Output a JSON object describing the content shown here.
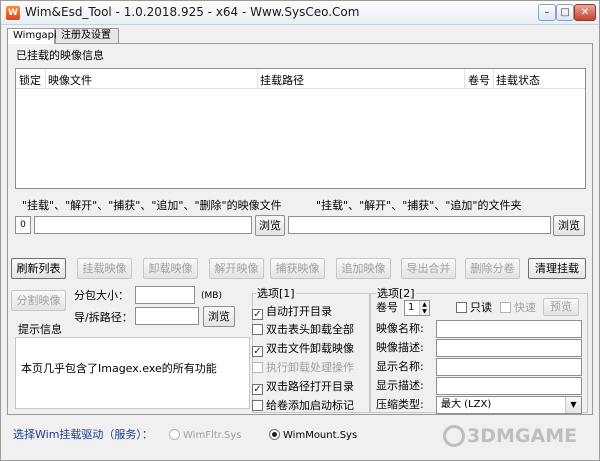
{
  "window": {
    "title": "Wim&Esd_Tool - 1.0.2018.925 - x64 - Www.SysCeo.Com",
    "min_glyph": "–",
    "max_glyph": "□",
    "close_glyph": "✕"
  },
  "tabs": [
    "Wimgapi",
    "注册及设置"
  ],
  "mounted": {
    "group_label": "已挂载的映像信息",
    "columns": [
      "锁定",
      "映像文件",
      "挂载路径",
      "卷号",
      "挂载状态"
    ]
  },
  "paths": {
    "image_label": "\"挂载\"、\"解开\"、\"捕获\"、\"追加\"、\"删除\"的映像文件",
    "folder_label": "\"挂载\"、\"解开\"、\"捕获\"、\"追加\"的文件夹",
    "small_box_value": "0",
    "browse_label_1": "浏览",
    "browse_label_2": "浏览"
  },
  "actions": [
    "刷新列表",
    "挂载映像",
    "卸载映像",
    "解开映像",
    "捕获映像",
    "追加映像",
    "导出合并",
    "删除分卷",
    "清理挂载"
  ],
  "split": {
    "button": "分割映像",
    "size_label": "分包大小：",
    "size_unit": "(MB)",
    "path_label": "导/拆路径：",
    "browse": "浏览"
  },
  "info": {
    "label": "提示信息",
    "text": "本页几乎包含了Imagex.exe的所有功能"
  },
  "options1": {
    "title": "选项[1]",
    "items": [
      {
        "label": "自动打开目录",
        "checked": true,
        "enabled": true
      },
      {
        "label": "双击表头卸载全部",
        "checked": false,
        "enabled": true
      },
      {
        "label": "双击文件卸载映像",
        "checked": true,
        "enabled": true
      },
      {
        "label": "执行卸载处理操作",
        "checked": false,
        "enabled": false
      },
      {
        "label": "双击路径打开目录",
        "checked": true,
        "enabled": true
      },
      {
        "label": "给卷添加启动标记",
        "checked": false,
        "enabled": true
      }
    ]
  },
  "options2": {
    "title": "选项[2]",
    "volume_label": "卷号",
    "volume_value": "1",
    "readonly_label": "只读",
    "fast_label": "快速",
    "fast_button": "预览",
    "fields": [
      "映像名称:",
      "映像描述:",
      "显示名称:",
      "显示描述:"
    ],
    "compress_label": "压缩类型:",
    "compress_value": "最大 (LZX)"
  },
  "driver": {
    "label": "选择Wim挂载驱动（服务）：",
    "options": [
      {
        "label": "WimFltr.Sys",
        "selected": false,
        "enabled": false
      },
      {
        "label": "WimMount.Sys",
        "selected": true,
        "enabled": true
      }
    ]
  },
  "watermark": "3DMGAME"
}
